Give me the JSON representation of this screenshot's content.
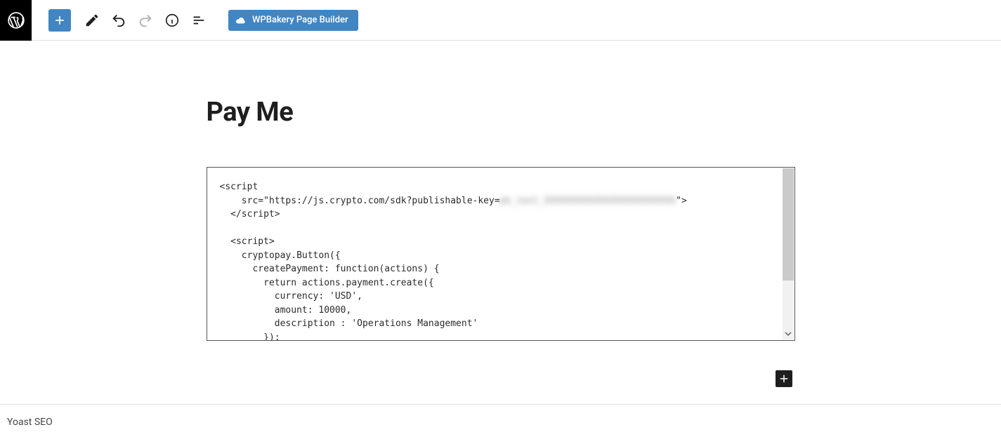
{
  "toolbar": {
    "wpbakery_label": "WPBakery Page Builder"
  },
  "post": {
    "title": "Pay Me"
  },
  "code": {
    "line1": "<script",
    "line2_pre": "    src=\"https://js.crypto.com/sdk?publishable-key=",
    "line2_blur": "pk_test_XXXXXXXXXXXXXXXXXXXXXXXX",
    "line2_post": "\">",
    "line3": "  </script>",
    "line4": "",
    "line5": "  <script>",
    "line6": "    cryptopay.Button({",
    "line7": "      createPayment: function(actions) {",
    "line8": "        return actions.payment.create({",
    "line9": "          currency: 'USD',",
    "line10": "          amount: 10000,",
    "line11": "          description : 'Operations Management'",
    "line12": "        });"
  },
  "footer": {
    "yoast_label": "Yoast SEO"
  }
}
